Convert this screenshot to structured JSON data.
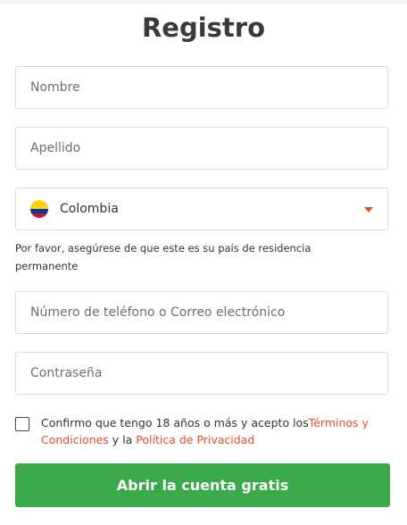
{
  "form": {
    "title": "Registro",
    "first_name": {
      "placeholder": "Nombre",
      "value": ""
    },
    "last_name": {
      "placeholder": "Apellido",
      "value": ""
    },
    "country": {
      "selected": "Colombia",
      "flag_icon": "colombia-flag-icon"
    },
    "residence_note": "Por favor, asegúrese de que este es su país de residencia permanente",
    "contact": {
      "placeholder": "Número de teléfono o Correo electrónico",
      "value": ""
    },
    "password": {
      "placeholder": "Contraseña",
      "value": ""
    },
    "consent": {
      "checked": false,
      "text_before": "Confirmo que tengo 18 años o más y acepto los",
      "terms_link": "Términos y Condiciones",
      "text_middle": " y la ",
      "privacy_link": "Política de Privacidad"
    },
    "submit_label": "Abrir la cuenta gratis"
  },
  "colors": {
    "accent": "#e84c2b",
    "button": "#3aa94a",
    "border": "#dcdcdc",
    "text": "#333333"
  }
}
